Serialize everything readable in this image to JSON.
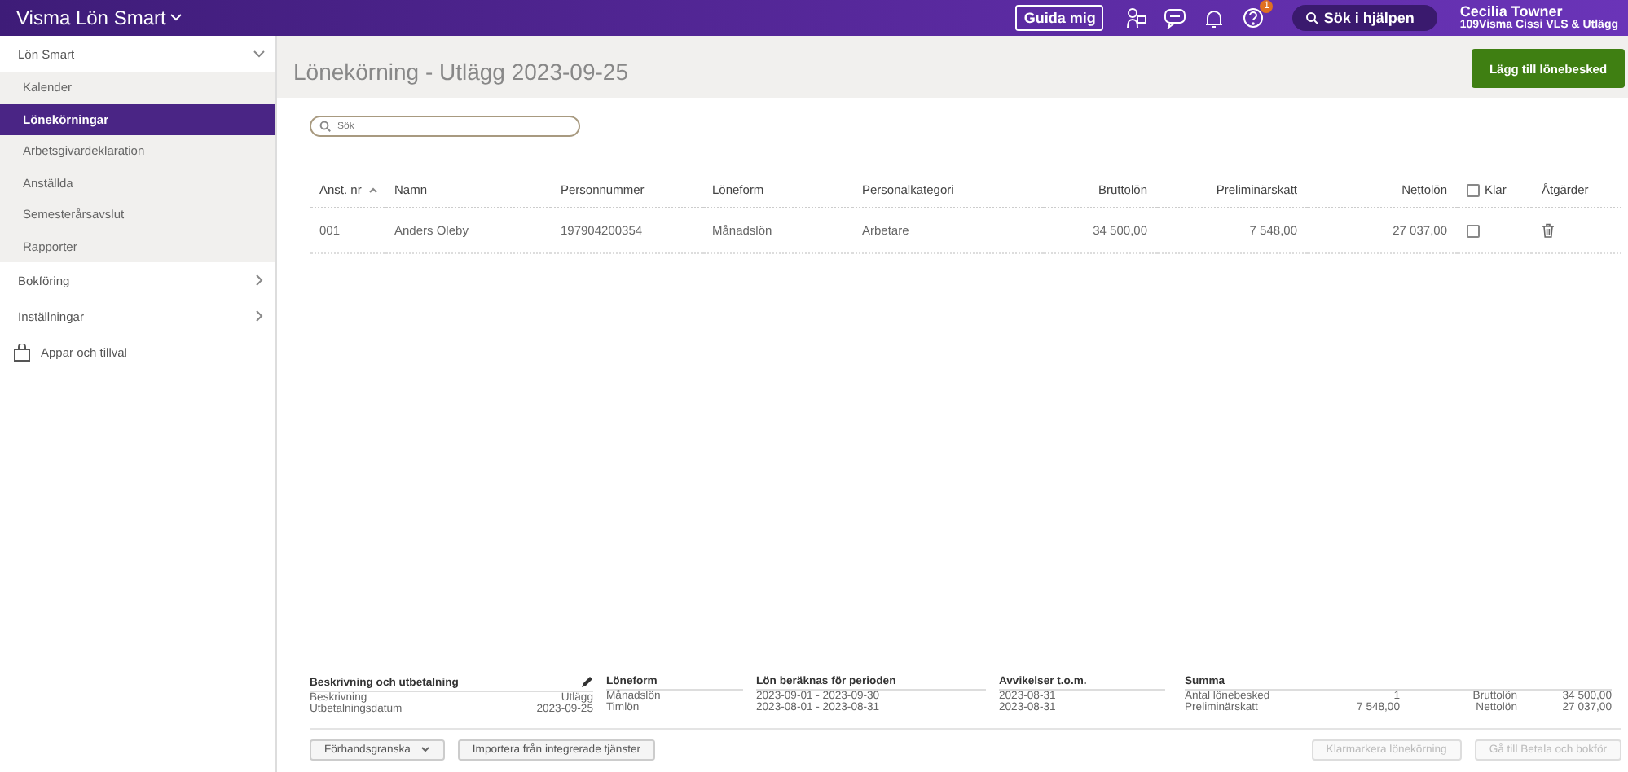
{
  "topbar": {
    "app_title": "Visma Lön Smart",
    "guide_button": "Guida mig",
    "help_badge": "1",
    "help_search": "Sök i hjälpen",
    "user_name": "Cecilia Towner",
    "company": "109Visma Cissi VLS & Utlägg"
  },
  "sidebar": {
    "items": [
      {
        "label": "Lön Smart",
        "kind": "group",
        "expanded": true,
        "selected": false,
        "children": [
          {
            "label": "Kalender",
            "selected": false
          },
          {
            "label": "Lönekörningar",
            "selected": true
          },
          {
            "label": "Arbetsgivardeklaration",
            "selected": false
          },
          {
            "label": "Anställda",
            "selected": false
          },
          {
            "label": "Semesterårsavslut",
            "selected": false
          },
          {
            "label": "Rapporter",
            "selected": false
          }
        ]
      },
      {
        "label": "Bokföring",
        "kind": "group",
        "expanded": false,
        "selected": false
      },
      {
        "label": "Inställningar",
        "kind": "group",
        "expanded": false,
        "selected": false
      },
      {
        "label": "Appar och tillval",
        "kind": "app",
        "selected": false
      }
    ]
  },
  "page": {
    "title": "Lönekörning - Utlägg 2023-09-25",
    "add_button": "Lägg till lönebesked",
    "search": {
      "placeholder": "Sök"
    }
  },
  "table": {
    "columns": [
      {
        "label": "Anst. nr",
        "kind": "text",
        "sorted": true
      },
      {
        "label": "Namn",
        "kind": "text",
        "sorted": false
      },
      {
        "label": "Personnummer",
        "kind": "text",
        "sorted": false
      },
      {
        "label": "Löneform",
        "kind": "text",
        "sorted": false
      },
      {
        "label": "Personalkategori",
        "kind": "text",
        "sorted": false
      },
      {
        "label": "Bruttolön",
        "kind": "amount",
        "sorted": false
      },
      {
        "label": "Preliminärskatt",
        "kind": "amount",
        "sorted": false
      },
      {
        "label": "Nettolön",
        "kind": "amount",
        "sorted": false
      },
      {
        "label": "Klar",
        "kind": "checkbox",
        "sorted": false,
        "checked": false
      },
      {
        "label": "Åtgärder",
        "kind": "text",
        "sorted": false
      }
    ],
    "rows": [
      {
        "cells": [
          "001",
          "Anders Oleby",
          "197904200354",
          "Månadslön",
          "Arbetare",
          "34 500,00",
          "7 548,00",
          "27 037,00"
        ],
        "klar": false
      }
    ]
  },
  "summary": {
    "description": {
      "title": "Beskrivning och utbetalning",
      "rows": [
        {
          "label": "Beskrivning",
          "value": "Utlägg"
        },
        {
          "label": "Utbetalningsdatum",
          "value": "2023-09-25"
        }
      ]
    },
    "columns": [
      {
        "title": "Löneform",
        "values": [
          "Månadslön",
          "Timlön"
        ]
      },
      {
        "title": "Lön beräknas för perioden",
        "values": [
          "2023-09-01 - 2023-09-30",
          "2023-08-01 - 2023-08-31"
        ]
      },
      {
        "title": "Avvikelser t.o.m.",
        "values": [
          "2023-08-31",
          "2023-08-31"
        ]
      }
    ],
    "totals": {
      "title": "Summa",
      "rows": [
        {
          "label": "Antal lönebesked",
          "value": "1",
          "label_2": "Bruttolön",
          "value_2": "34 500,00"
        },
        {
          "label": "Preliminärskatt",
          "value": "7 548,00",
          "label_2": "Nettolön",
          "value_2": "27 037,00"
        }
      ]
    }
  },
  "footer": {
    "buttons": [
      {
        "label": "Förhandsgranska",
        "kind": "dropdown",
        "disabled": false
      },
      {
        "label": "Importera från integrerade tjänster",
        "kind": "plain",
        "disabled": false
      },
      {
        "label": "Klarmarkera lönekörning",
        "kind": "plain",
        "disabled": true
      },
      {
        "label": "Gå till Betala och bokför",
        "kind": "plain",
        "disabled": true
      }
    ]
  }
}
